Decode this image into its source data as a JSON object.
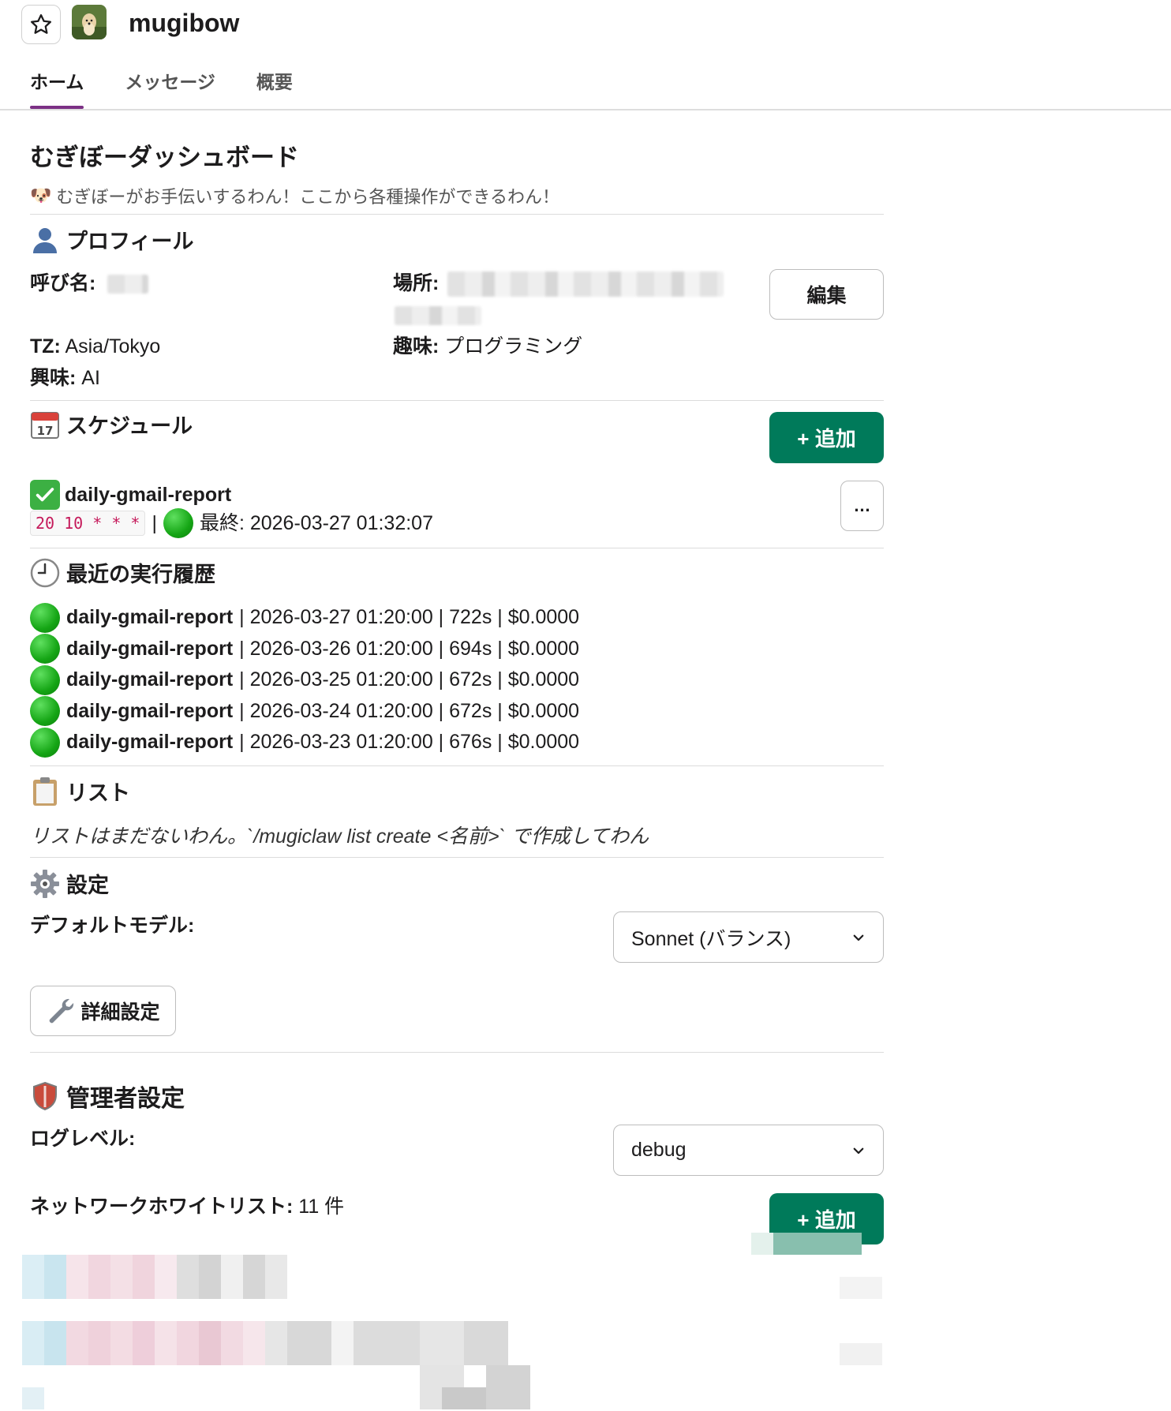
{
  "header": {
    "app_name": "mugibow",
    "tabs": [
      {
        "label": "ホーム",
        "active": true
      },
      {
        "label": "メッセージ",
        "active": false
      },
      {
        "label": "概要",
        "active": false
      }
    ]
  },
  "dashboard": {
    "title": "むぎぼーダッシュボード",
    "subtitle": "むぎぼーがお手伝いするわん！ここから各種操作ができるわん！"
  },
  "profile": {
    "title": "プロフィール",
    "nickname_label": "呼び名:",
    "location_label": "場所:",
    "tz_label": "TZ:",
    "tz_value": "Asia/Tokyo",
    "hobby_label": "趣味:",
    "hobby_value": "プログラミング",
    "interest_label": "興味:",
    "interest_value": "AI",
    "edit_label": "編集"
  },
  "schedule": {
    "title": "スケジュール",
    "add_label": "+ 追加",
    "item": {
      "name": "daily-gmail-report",
      "cron": "20 10 * * *",
      "separator": "|",
      "last_run": "最終: 2026-03-27 01:32:07",
      "more_label": "…"
    }
  },
  "history": {
    "title": "最近の実行履歴",
    "rows": [
      {
        "name": "daily-gmail-report",
        "details": "| 2026-03-27 01:20:00 | 722s | $0.0000"
      },
      {
        "name": "daily-gmail-report",
        "details": "| 2026-03-26 01:20:00 | 694s | $0.0000"
      },
      {
        "name": "daily-gmail-report",
        "details": "| 2026-03-25 01:20:00 | 672s | $0.0000"
      },
      {
        "name": "daily-gmail-report",
        "details": "| 2026-03-24 01:20:00 | 672s | $0.0000"
      },
      {
        "name": "daily-gmail-report",
        "details": "| 2026-03-23 01:20:00 | 676s | $0.0000"
      }
    ]
  },
  "list": {
    "title": "リスト",
    "empty_message": "リストはまだないわん。`/mugiclaw list create <名前>` で作成してわん"
  },
  "settings": {
    "title": "設定",
    "default_model_label": "デフォルトモデル:",
    "default_model_value": "Sonnet (バランス)",
    "advanced_label": "詳細設定"
  },
  "admin": {
    "title": "管理者設定",
    "log_level_label": "ログレベル:",
    "log_level_value": "debug",
    "whitelist_label": "ネットワークホワイトリスト:",
    "whitelist_count": "11 件",
    "add_label": "+ 追加"
  },
  "colors": {
    "accent_tab": "#7c3085",
    "primary_button": "#007a5a",
    "code_text": "#c5195a"
  }
}
